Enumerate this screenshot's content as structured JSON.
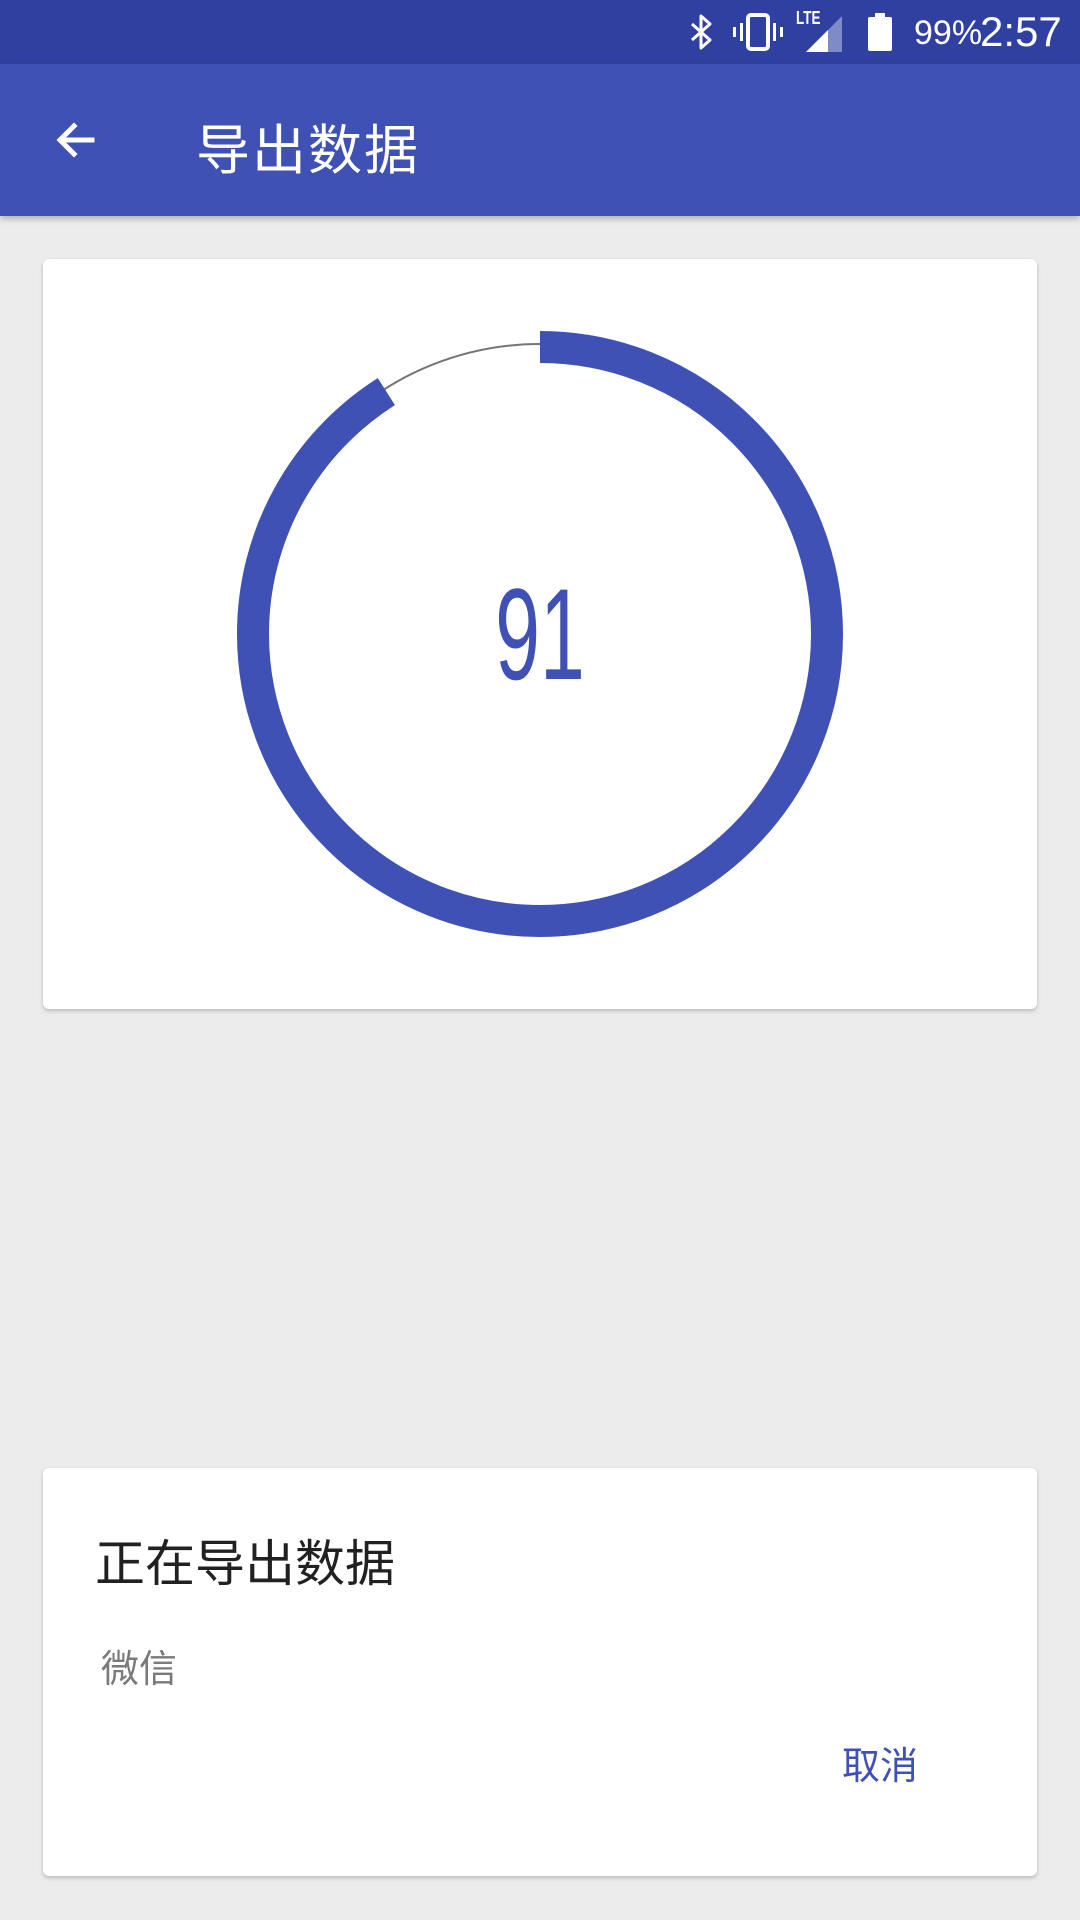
{
  "status_bar": {
    "battery_percent": "99%",
    "time": "2:57",
    "icons": [
      "bluetooth-icon",
      "vibrate-icon",
      "lte-signal-icon",
      "battery-icon"
    ],
    "network_label": "LTE"
  },
  "app_bar": {
    "title": "导出数据",
    "back_icon": "arrow-back-icon"
  },
  "progress": {
    "value": "91",
    "percent": 91
  },
  "dialog": {
    "title": "正在导出数据",
    "message": "微信",
    "cancel_label": "取消"
  },
  "colors": {
    "primary": "#3f51b5",
    "primary_dark": "#3040a0",
    "background": "#ececec"
  }
}
